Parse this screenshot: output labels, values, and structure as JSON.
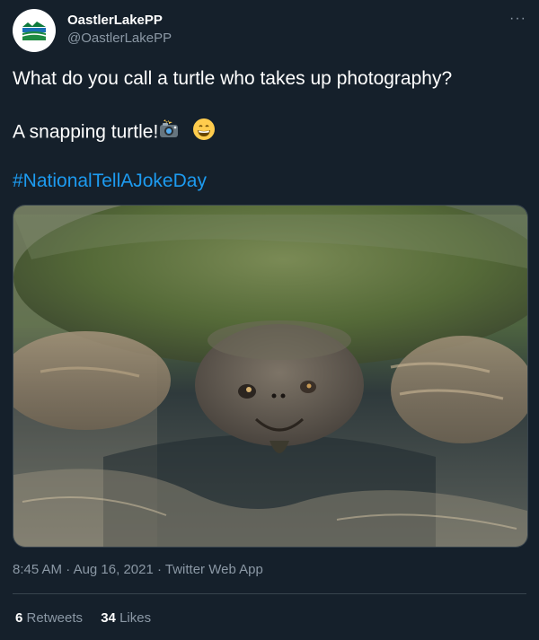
{
  "author": {
    "display_name": "OastlerLakePP",
    "handle": "@OastlerLakePP",
    "avatar_icon": "park-logo-icon"
  },
  "more_icon": "more-dots-icon",
  "tweet": {
    "line1": "What do you call a turtle who takes up photography?",
    "line2": "A snapping turtle!",
    "hashtag": "#NationalTellAJokeDay",
    "emojis": [
      "camera-flash-icon",
      "grinning-face-icon"
    ]
  },
  "media": {
    "icon": "snapping-turtle-photo"
  },
  "meta": {
    "time": "8:45 AM",
    "sep1": " · ",
    "date": "Aug 16, 2021",
    "sep2": " · ",
    "source": "Twitter Web App"
  },
  "stats": {
    "retweets_count": "6",
    "retweets_label": " Retweets",
    "likes_count": "34",
    "likes_label": " Likes"
  },
  "colors": {
    "background": "#15202b",
    "link": "#1d9bf0",
    "muted": "#8b98a5",
    "divider": "#38444d"
  }
}
